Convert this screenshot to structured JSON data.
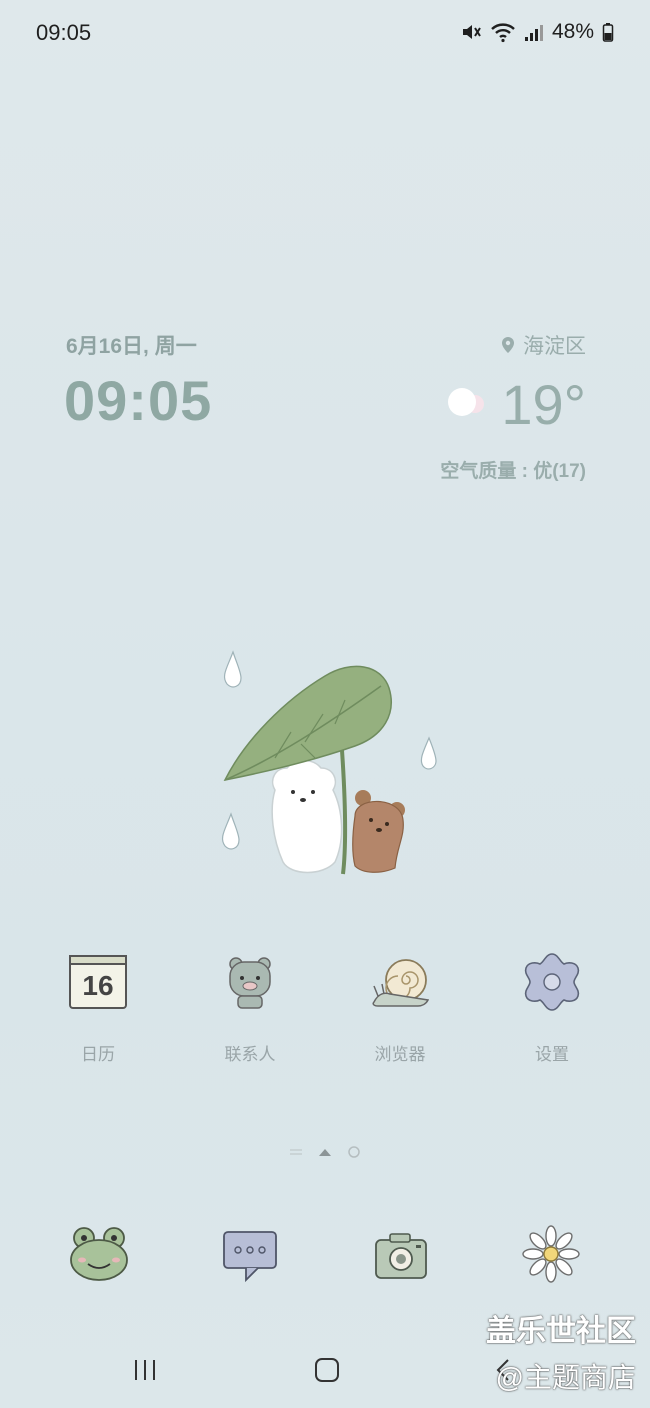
{
  "status_bar": {
    "time": "09:05",
    "battery": "48%",
    "icons": [
      "mute-icon",
      "wifi-icon",
      "signal-icon",
      "battery-icon"
    ]
  },
  "weather_widget": {
    "date": "6月16日, 周一",
    "time": "09:05",
    "location": "海淀区",
    "temperature": "19°",
    "air_quality": "空气质量 : 优(17)",
    "weather_icon": "partly-cloudy-icon"
  },
  "apps": [
    {
      "label": "日历",
      "icon": "calendar-icon",
      "badge": "16"
    },
    {
      "label": "联系人",
      "icon": "contacts-icon"
    },
    {
      "label": "浏览器",
      "icon": "browser-icon"
    },
    {
      "label": "设置",
      "icon": "settings-icon"
    }
  ],
  "page_indicator": {
    "pages": 3,
    "current": 2
  },
  "dock": [
    {
      "icon": "phone-icon"
    },
    {
      "icon": "messages-icon"
    },
    {
      "icon": "camera-icon"
    },
    {
      "icon": "gallery-icon"
    }
  ],
  "nav_bar": {
    "icons": [
      "recents-icon",
      "home-icon",
      "back-icon"
    ]
  },
  "watermark": {
    "line1": "盖乐世社区",
    "line2": "@主题商店"
  },
  "colors": {
    "background": "#dce7ea",
    "widget_text": "#8fa8a3",
    "label_text": "#9aa5a8"
  }
}
